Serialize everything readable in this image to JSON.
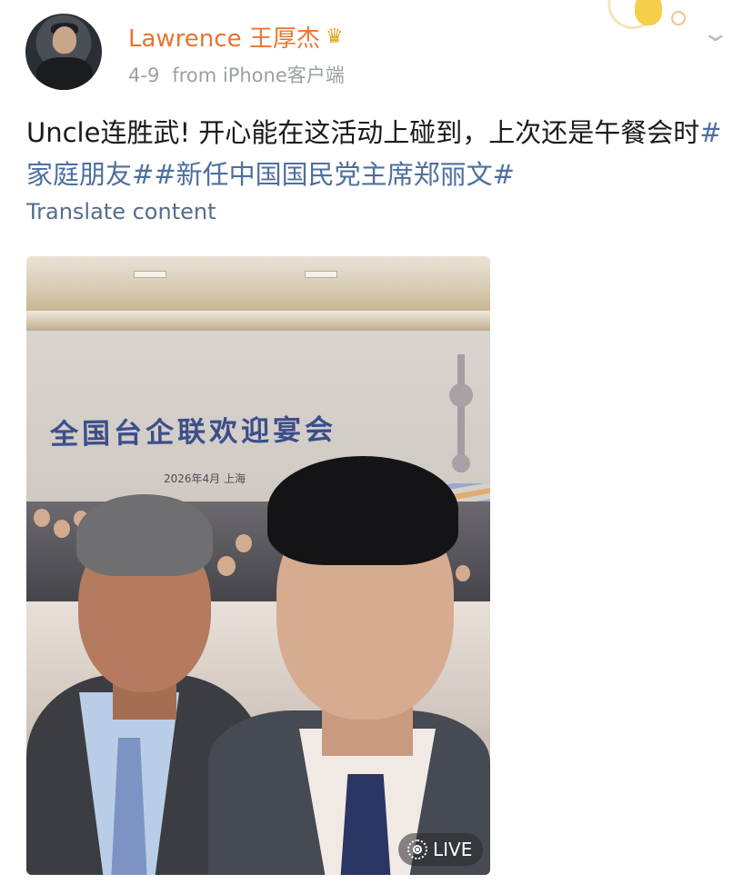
{
  "post": {
    "username": "Lawrence 王厚杰",
    "badge_icon": "crown-icon",
    "date": "4-9",
    "source": "from iPhone客户端",
    "text_plain": "Uncle连胜武! 开心能在这活动上碰到，上次还是午餐会时",
    "hashtags": [
      "#家庭朋友#",
      "#新任中国国民党主席郑丽文#"
    ],
    "translate_label": "Translate content",
    "more_icon": "chevron-down-icon"
  },
  "photo": {
    "banner_title": "全国台企联欢迎宴会",
    "banner_subtitle": "2026年4月 上海",
    "live_label": "LIVE",
    "live_icon": "live-photo-icon"
  },
  "colors": {
    "username": "#e8742f",
    "hashtag": "#4e6fa0",
    "translate": "#546d8e",
    "meta": "#9aa0a6"
  }
}
